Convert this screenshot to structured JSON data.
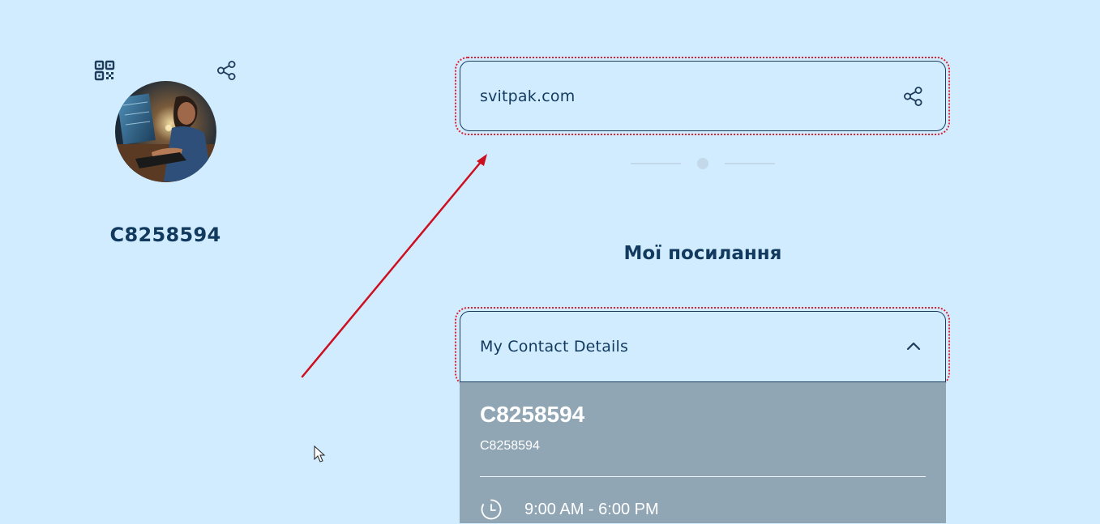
{
  "profile": {
    "name": "C8258594",
    "qr_icon": "qr-code-icon",
    "share_icon": "share-icon",
    "avatar_alt": "avatar"
  },
  "links": {
    "website": {
      "label": "svitpak.com",
      "icon": "share-icon"
    },
    "section_title": "Мої посилання",
    "contact_accordion": {
      "label": "My Contact Details",
      "icon": "chevron-up-icon",
      "expanded": true,
      "details": {
        "name": "C8258594",
        "subtitle": "C8258594",
        "hours_icon": "clock-icon",
        "hours": "9:00 AM - 6:00 PM"
      }
    }
  },
  "carousel": {
    "active_index": 1,
    "count": 3
  },
  "colors": {
    "background": "#d1ecff",
    "text_primary": "#123a5e",
    "panel": "#91a6b4",
    "annotation": "#cc1020"
  }
}
